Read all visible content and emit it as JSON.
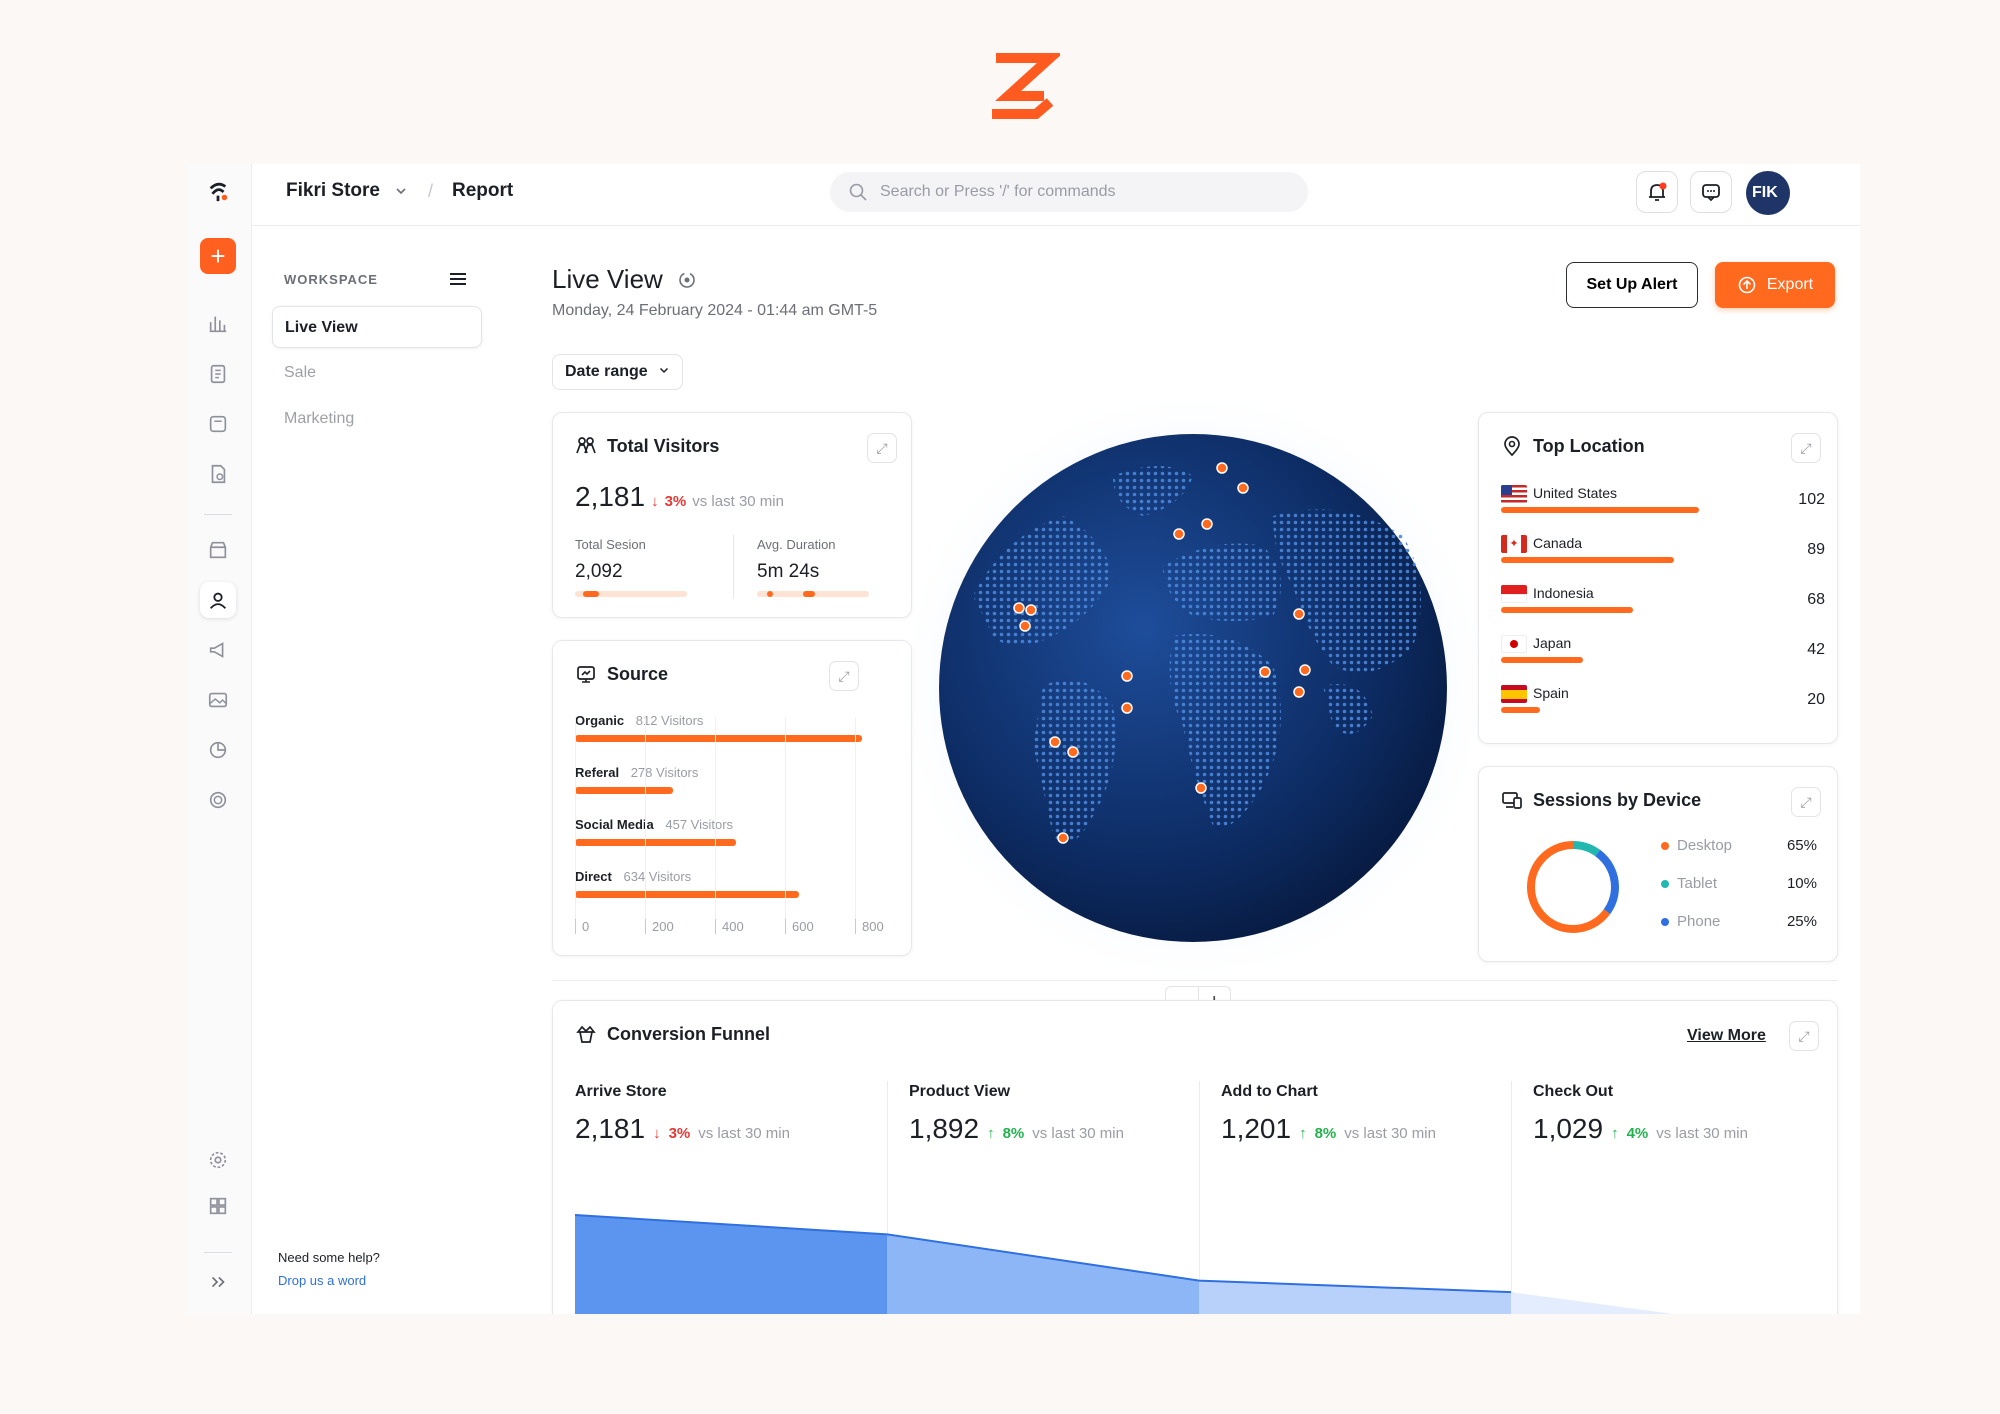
{
  "topbar": {
    "store_name": "Fikri Store",
    "breadcrumb_current": "Report",
    "search_placeholder": "Search or Press '/' for commands",
    "avatar_initials": "FIK"
  },
  "sidebar": {
    "workspace_title": "WORKSPACE",
    "items": [
      {
        "label": "Live View",
        "active": true
      },
      {
        "label": "Sale",
        "active": false
      },
      {
        "label": "Marketing",
        "active": false
      }
    ],
    "help_text": "Need some help?",
    "help_link": "Drop us a word"
  },
  "page": {
    "title": "Live View",
    "date": "Monday, 24 February 2024 - 01:44 am GMT-5",
    "set_alert_label": "Set Up Alert",
    "export_label": "Export",
    "date_range_label": "Date range"
  },
  "total_visitors": {
    "title": "Total Visitors",
    "value": "2,181",
    "change": "3%",
    "compare": "vs last 30 min",
    "session_label": "Total Sesion",
    "session_value": "2,092",
    "duration_label": "Avg. Duration",
    "duration_value": "5m 24s"
  },
  "source": {
    "title": "Source",
    "items": [
      {
        "name": "Organic",
        "visitors": "812 Visitors",
        "value": 812
      },
      {
        "name": "Referal",
        "visitors": "278 Visitors",
        "value": 278
      },
      {
        "name": "Social Media",
        "visitors": "457 Visitors",
        "value": 457
      },
      {
        "name": "Direct",
        "visitors": "634 Visitors",
        "value": 634
      }
    ],
    "ticks": [
      "0",
      "200",
      "400",
      "600",
      "800"
    ],
    "max": 850
  },
  "top_location": {
    "title": "Top Location",
    "items": [
      {
        "name": "United States",
        "value": "102",
        "num": 102
      },
      {
        "name": "Canada",
        "value": "89",
        "num": 89
      },
      {
        "name": "Indonesia",
        "value": "68",
        "num": 68
      },
      {
        "name": "Japan",
        "value": "42",
        "num": 42
      },
      {
        "name": "Spain",
        "value": "20",
        "num": 20
      }
    ]
  },
  "sessions_device": {
    "title": "Sessions by Device",
    "items": [
      {
        "name": "Desktop",
        "pct": "65%",
        "value": 65,
        "color": "#ff6a1f"
      },
      {
        "name": "Tablet",
        "pct": "10%",
        "value": 10,
        "color": "#22b8b0"
      },
      {
        "name": "Phone",
        "pct": "25%",
        "value": 25,
        "color": "#2f6fe0"
      }
    ]
  },
  "funnel": {
    "title": "Conversion Funnel",
    "view_more": "View More",
    "stages": [
      {
        "label": "Arrive Store",
        "value": "2,181",
        "change": "3%",
        "dir": "down",
        "compare": "vs last 30 min",
        "num": 2181
      },
      {
        "label": "Product View",
        "value": "1,892",
        "change": "8%",
        "dir": "up",
        "compare": "vs last 30 min",
        "num": 1892
      },
      {
        "label": "Add to Chart",
        "value": "1,201",
        "change": "8%",
        "dir": "up",
        "compare": "vs last 30 min",
        "num": 1201
      },
      {
        "label": "Check Out",
        "value": "1,029",
        "change": "4%",
        "dir": "up",
        "compare": "vs last 30 min",
        "num": 1029
      }
    ]
  },
  "colors": {
    "accent": "#ff6a1f",
    "blue": "#2f6fe0",
    "globe": "#0d2c64"
  }
}
